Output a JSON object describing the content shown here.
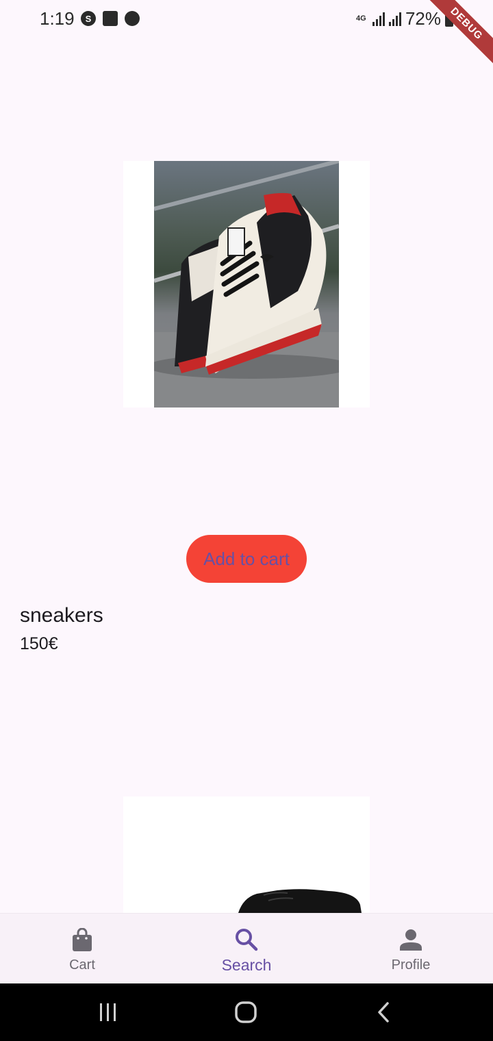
{
  "status_bar": {
    "time": "1:19",
    "network": "4G",
    "battery": "72%"
  },
  "debug_banner": "DEBUG",
  "products": [
    {
      "name": "sneakers",
      "price": "150€",
      "add_to_cart_label": "Add to cart"
    }
  ],
  "bottom_nav": {
    "items": [
      {
        "label": "Cart",
        "icon": "shopping-bag-icon"
      },
      {
        "label": "Search",
        "icon": "search-icon"
      },
      {
        "label": "Profile",
        "icon": "person-icon"
      }
    ],
    "active": "Search"
  },
  "colors": {
    "background": "#fdf7fd",
    "add_to_cart_bg": "#f44336",
    "primary": "#6750a4",
    "nav_inactive": "#6b6870"
  }
}
